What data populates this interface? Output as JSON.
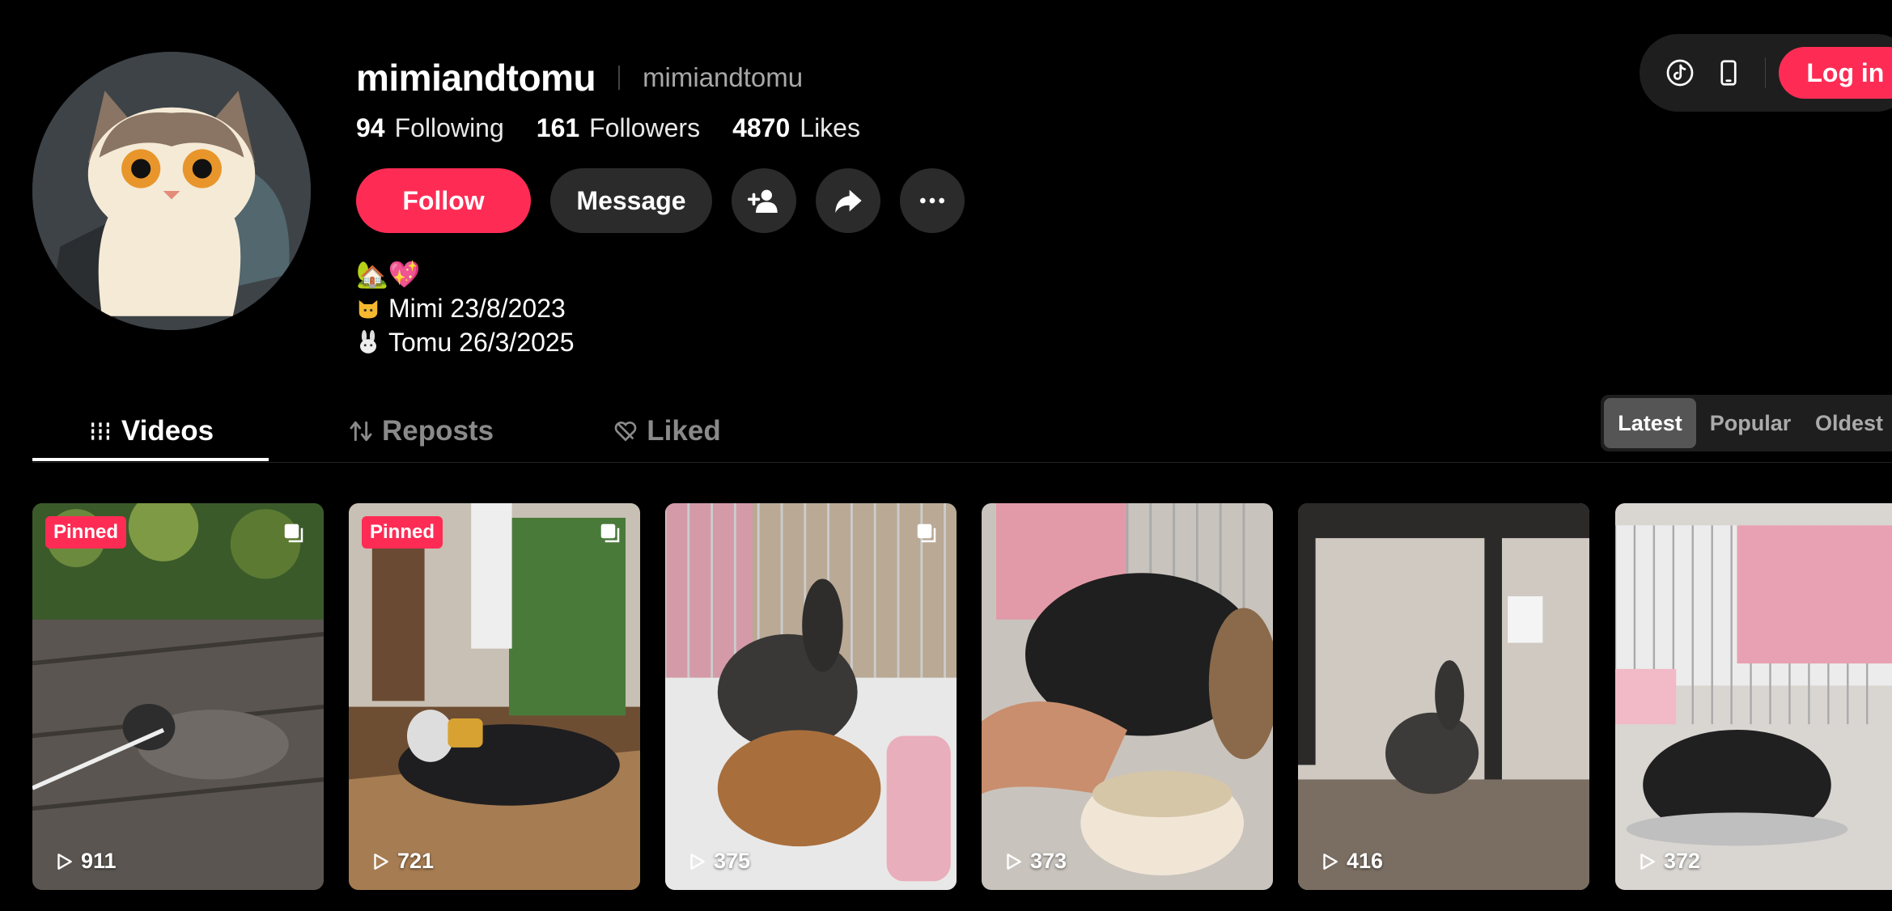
{
  "profile": {
    "username": "mimiandtomu",
    "nickname": "mimiandtomu",
    "stats": {
      "following_count": "94",
      "following_label": "Following",
      "followers_count": "161",
      "followers_label": "Followers",
      "likes_count": "4870",
      "likes_label": "Likes"
    },
    "actions": {
      "follow": "Follow",
      "message": "Message"
    },
    "bio": {
      "line1": "🏡💖",
      "line2": "Mimi 23/8/2023",
      "line3": "Tomu 26/3/2025"
    }
  },
  "top_pill": {
    "login": "Log in"
  },
  "tabs": {
    "videos": "Videos",
    "reposts": "Reposts",
    "liked": "Liked"
  },
  "sort": {
    "latest": "Latest",
    "popular": "Popular",
    "oldest": "Oldest",
    "selected": "Latest"
  },
  "videos": [
    {
      "views": "911",
      "badge": "Pinned"
    },
    {
      "views": "721",
      "badge": "Pinned"
    },
    {
      "views": "375"
    },
    {
      "views": "373"
    },
    {
      "views": "416"
    },
    {
      "views": "372"
    }
  ],
  "colors": {
    "accent": "#fe2c55",
    "background": "#000000",
    "surface": "#2b2b2b"
  }
}
